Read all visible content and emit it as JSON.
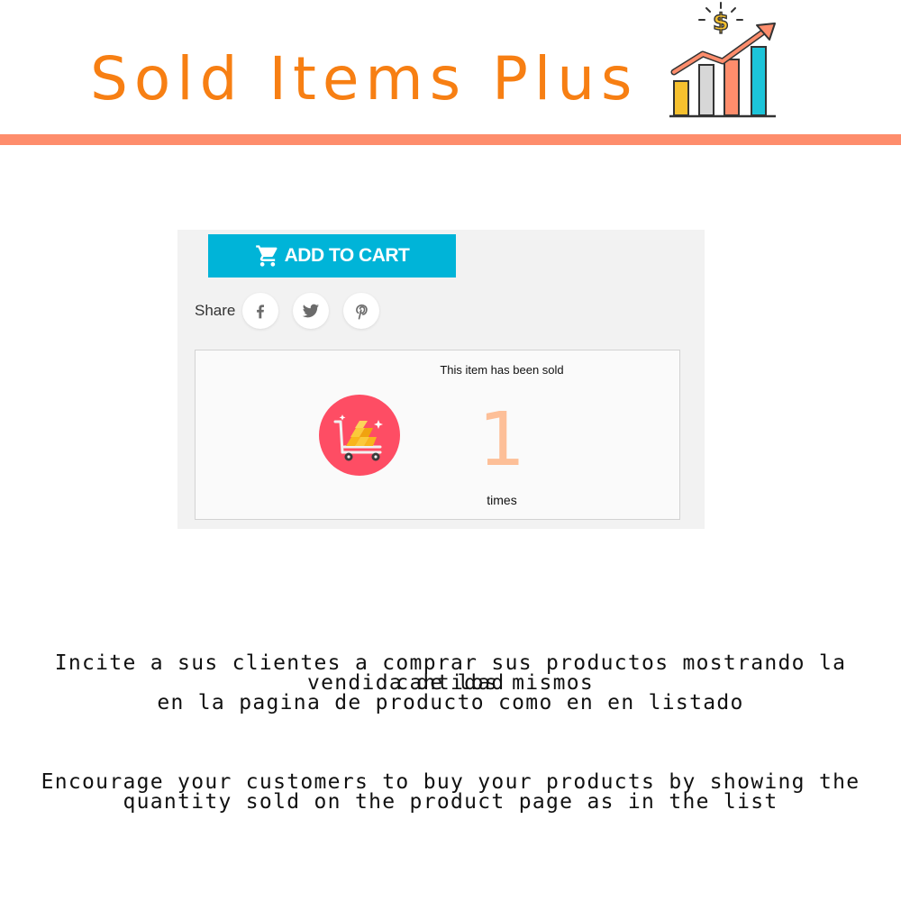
{
  "header": {
    "title": "Sold Items Plus",
    "title_color": "#f77f13",
    "divider_color": "#fe8d6c",
    "logo_icon": "sales-growth-chart-icon"
  },
  "product": {
    "add_to_cart_label": "ADD TO CART",
    "add_to_cart_color": "#00b4d8",
    "share_label": "Share",
    "social": [
      "facebook-icon",
      "twitter-icon",
      "pinterest-icon"
    ]
  },
  "sold_widget": {
    "heading": "This item has been sold",
    "count": "1",
    "unit": "times",
    "count_color": "#fdbf98",
    "icon": "gold-cart-icon",
    "icon_bg_color": "#fe4d64"
  },
  "description": {
    "es_line1": "Incite a sus clientes a comprar sus productos mostrando la cantidad",
    "es_line2": "vendida de los mismos",
    "es_line3": "en la pagina de producto como en en listado",
    "en_line1": "Encourage your customers to buy your products by showing the",
    "en_line2": "quantity sold on the product page as in the list"
  }
}
